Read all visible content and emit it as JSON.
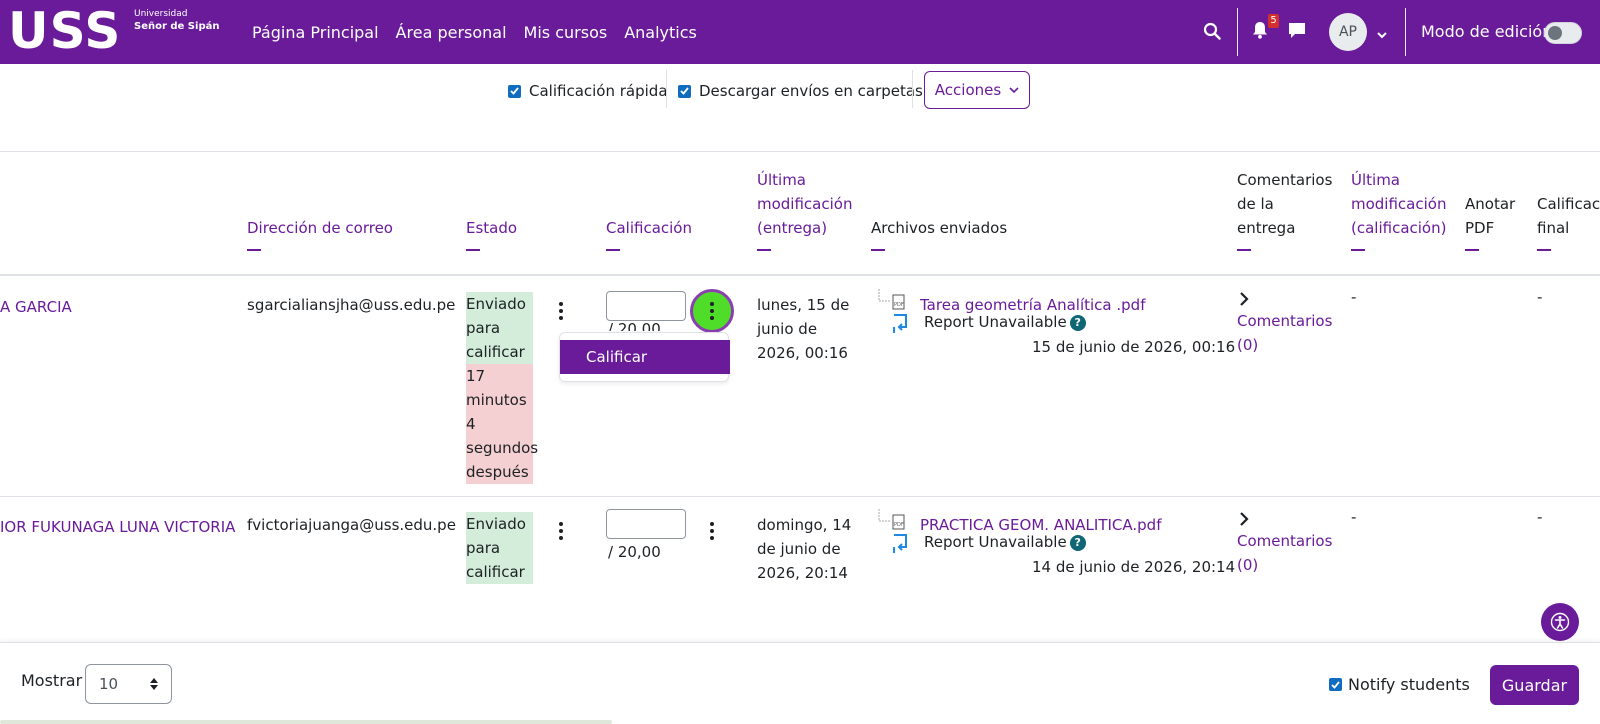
{
  "brand": {
    "letters": "USS",
    "line1": "Universidad",
    "line2": "Señor de Sipán"
  },
  "nav": {
    "links": [
      "Página Principal",
      "Área personal",
      "Mis cursos",
      "Analytics"
    ],
    "notif_count": "5",
    "avatar": "AP",
    "edit_mode": "Modo de edición"
  },
  "options": {
    "quick_grading": "Calificación rápida",
    "download_folders": "Descargar envíos en carpetas",
    "actions": "Acciones"
  },
  "columns": {
    "email": "Dirección de correo",
    "status": "Estado",
    "grade": "Calificación",
    "last_mod_line1": "Última",
    "last_mod_line2": "modificación",
    "last_mod_line3": "(entrega)",
    "files": "Archivos enviados",
    "comments_line1": "Comentarios",
    "comments_line2": "de la",
    "comments_line3": "entrega",
    "last_grade_line1": "Última",
    "last_grade_line2": "modificación",
    "last_grade_line3": "(calificación)",
    "annotate_line1": "Anotar",
    "annotate_line2": "PDF",
    "final_line1": "Calificación",
    "final_line2": "final"
  },
  "rows": [
    {
      "name": "A GARCIA",
      "email": "sgarcialiansjha@uss.edu.pe",
      "status_lines": [
        "Enviado",
        "para",
        "calificar"
      ],
      "late_lines": [
        "17",
        "minutos",
        "4",
        "segundos",
        "después"
      ],
      "grade_max": "/ 20,00",
      "date_lines": [
        "lunes, 15 de",
        "junio de",
        "2026, 00:16"
      ],
      "file": "Tarea geometría Analítica .pdf",
      "report": "Report Unavailable",
      "file_date": "15 de junio de 2026, 00:16",
      "comments": "Comentarios",
      "comments_count": "(0)",
      "last_grade": "-",
      "final": "-"
    },
    {
      "name": "IOR FUKUNAGA LUNA VICTORIA",
      "email": "fvictoriajuanga@uss.edu.pe",
      "status_lines": [
        "Enviado",
        "para",
        "calificar"
      ],
      "grade_max": "/ 20,00",
      "date_lines": [
        "domingo, 14",
        "de junio de",
        "2026, 20:14"
      ],
      "file": "PRACTICA GEOM. ANALITICA.pdf",
      "report": "Report Unavailable",
      "file_date": "14 de junio de 2026, 20:14",
      "comments": "Comentarios",
      "comments_count": "(0)",
      "last_grade": "-",
      "final": "-"
    }
  ],
  "menu": {
    "grade_item": "Calificar"
  },
  "footer": {
    "show_label": "Mostrar",
    "show_value": "10",
    "notify": "Notify students",
    "save": "Guardar"
  },
  "colors": {
    "brand": "#6a1b9a",
    "highlight": "#4fdd2a"
  }
}
